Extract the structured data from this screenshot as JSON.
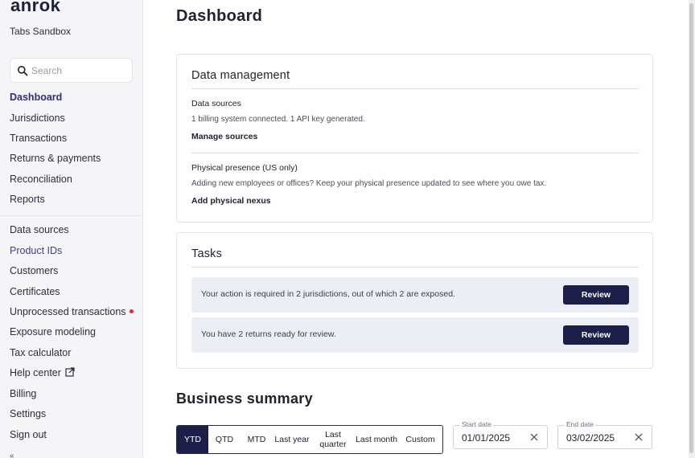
{
  "app": {
    "logo": "anrok",
    "workspace": "Tabs Sandbox"
  },
  "search": {
    "placeholder": "Search",
    "value": ""
  },
  "nav_primary": [
    {
      "label": "Dashboard",
      "active": true
    },
    {
      "label": "Jurisdictions"
    },
    {
      "label": "Transactions"
    },
    {
      "label": "Returns & payments"
    },
    {
      "label": "Reconciliation"
    },
    {
      "label": "Reports"
    }
  ],
  "nav_secondary": [
    {
      "label": "Data sources"
    },
    {
      "label": "Product IDs"
    },
    {
      "label": "Customers"
    },
    {
      "label": "Certificates"
    },
    {
      "label": "Unprocessed transactions"
    },
    {
      "label": "Exposure modeling"
    },
    {
      "label": "Tax calculator"
    },
    {
      "label": "Help center"
    },
    {
      "label": "Billing"
    },
    {
      "label": "Settings"
    },
    {
      "label": "Sign out"
    }
  ],
  "sidebar_footer": "«",
  "page": {
    "title": "Dashboard"
  },
  "data_management": {
    "title": "Data management",
    "sources_label": "Data sources",
    "sources_desc": "1 billing system connected. 1 API key generated.",
    "sources_link": "Manage sources",
    "presence_label": "Physical presence (US only)",
    "presence_desc": "Adding new employees or offices? Keep your physical presence updated to see where you owe tax.",
    "presence_link": "Add physical nexus"
  },
  "tasks": {
    "title": "Tasks",
    "items": [
      {
        "text": "Your action is required in 2 jurisdictions, out of which 2 are exposed.",
        "button": "Review"
      },
      {
        "text": "You have 2 returns ready for review.",
        "button": "Review"
      }
    ]
  },
  "business_summary": {
    "title": "Business summary",
    "periods": [
      "YTD",
      "QTD",
      "MTD",
      "Last year",
      "Last quarter",
      "Last month",
      "Custom"
    ],
    "selected_period": "YTD",
    "start_date_label": "Start date",
    "start_date": "01/01/2025",
    "end_date_label": "End date",
    "end_date": "03/02/2025"
  },
  "colors": {
    "primary": "#1c1f4a",
    "alert_dot": "#e0283a",
    "task_bg": "#eceef6"
  }
}
